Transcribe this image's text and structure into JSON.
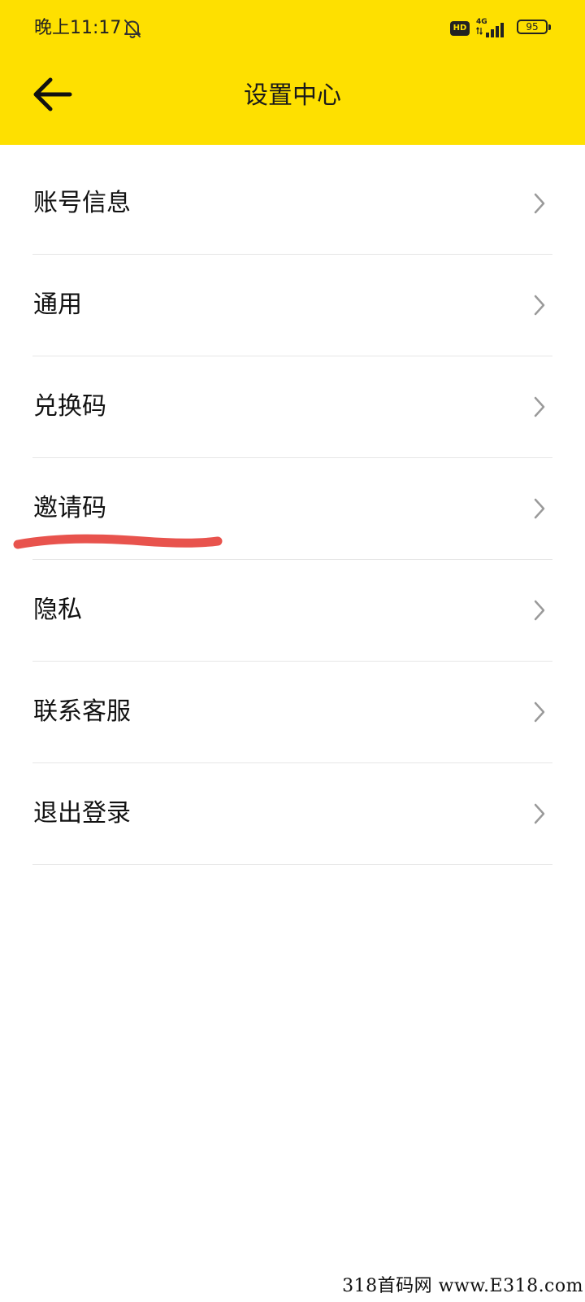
{
  "status_bar": {
    "time": "晚上11:17",
    "hd_label": "HD",
    "network_label": "4G",
    "battery_level": "95",
    "icons": [
      "bell-off-icon",
      "hd-icon",
      "signal-icon",
      "battery-icon"
    ]
  },
  "header": {
    "title": "设置中心",
    "back_icon": "arrow-left-icon",
    "background_color": "#FEE000"
  },
  "menu": {
    "items": [
      {
        "label": "账号信息"
      },
      {
        "label": "通用"
      },
      {
        "label": "兑换码"
      },
      {
        "label": "邀请码",
        "annotated": true
      },
      {
        "label": "隐私"
      },
      {
        "label": "联系客服"
      },
      {
        "label": "退出登录"
      }
    ],
    "chevron_icon": "chevron-right-icon"
  },
  "annotation": {
    "underline_color": "#E8534D",
    "target": "邀请码"
  },
  "watermark": {
    "text": "318首码网  www.E318.com"
  }
}
